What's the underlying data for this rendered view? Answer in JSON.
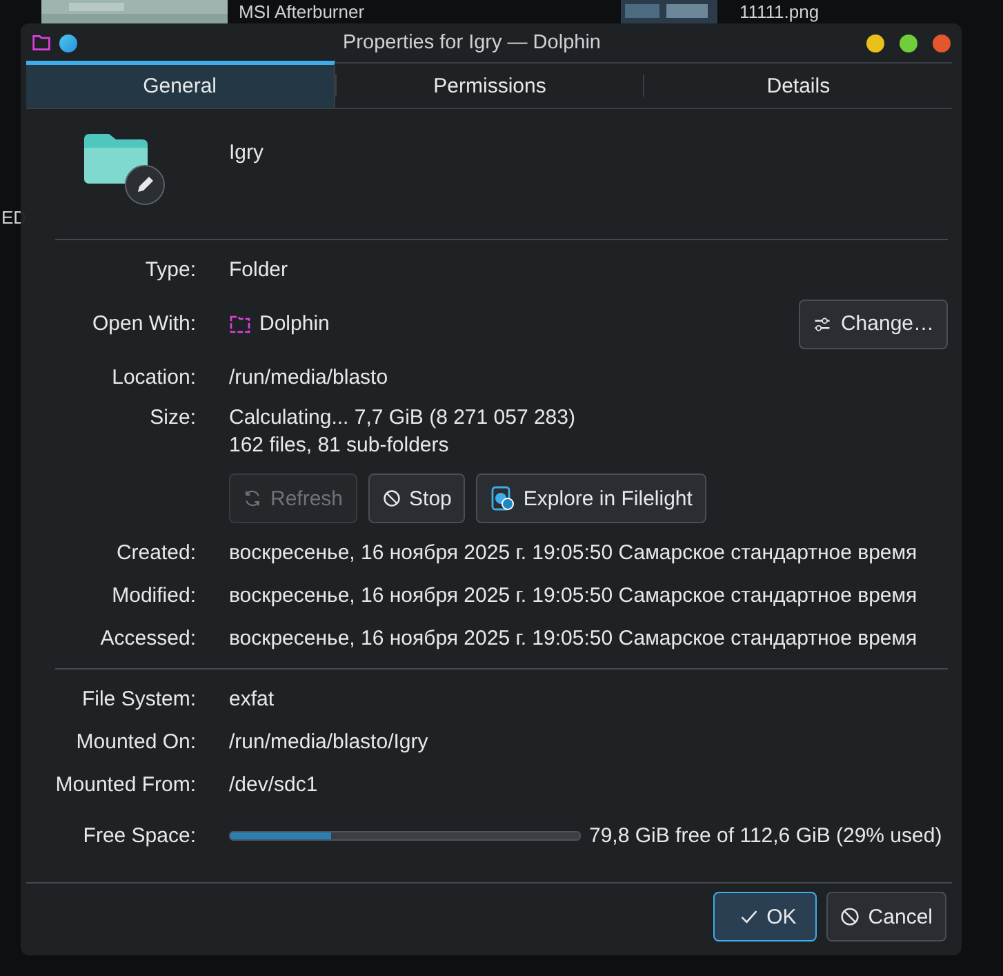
{
  "background": {
    "labels": [
      "MSI Afterburner",
      "11111.png",
      "ED"
    ]
  },
  "window": {
    "title": "Properties for Igry — Dolphin"
  },
  "tabs": [
    {
      "label": "General",
      "selected": true
    },
    {
      "label": "Permissions",
      "selected": false
    },
    {
      "label": "Details",
      "selected": false
    }
  ],
  "file": {
    "name": "Igry"
  },
  "general": [
    {
      "kind": "text",
      "label": "Type:",
      "value": "Folder"
    },
    {
      "kind": "app",
      "label": "Open With:",
      "value": "Dolphin",
      "button": "Change…"
    },
    {
      "kind": "text",
      "label": "Location:",
      "value": "/run/media/blasto"
    },
    {
      "kind": "size",
      "label": "Size:",
      "lines": [
        "Calculating... 7,7 GiB (8 271 057 283)",
        "162 files, 81 sub-folders"
      ],
      "buttons": [
        {
          "kind": "refresh",
          "label": "Refresh",
          "disabled": true
        },
        {
          "kind": "stop",
          "label": "Stop",
          "disabled": false
        },
        {
          "kind": "filelight",
          "label": "Explore in Filelight",
          "disabled": false
        }
      ]
    },
    {
      "kind": "text",
      "label": "Created:",
      "value": "воскресенье, 16 ноября 2025 г. 19:05:50 Самарское стандартное время"
    },
    {
      "kind": "text",
      "label": "Modified:",
      "value": "воскресенье, 16 ноября 2025 г. 19:05:50 Самарское стандартное время"
    },
    {
      "kind": "text",
      "label": "Accessed:",
      "value": "воскресенье, 16 ноября 2025 г. 19:05:50 Самарское стандартное время"
    }
  ],
  "filesystem": [
    {
      "label": "File System:",
      "value": "exfat"
    },
    {
      "label": "Mounted On:",
      "value": "/run/media/blasto/Igry"
    },
    {
      "label": "Mounted From:",
      "value": "/dev/sdc1"
    }
  ],
  "free_space": {
    "label": "Free Space:",
    "level": 0.29,
    "reading": "79,8 GiB free of 112,6 GiB (29% used)"
  },
  "buttons": [
    {
      "kind": "ok",
      "label": "OK",
      "default": true
    },
    {
      "kind": "cancel",
      "label": "Cancel",
      "default": false
    }
  ]
}
